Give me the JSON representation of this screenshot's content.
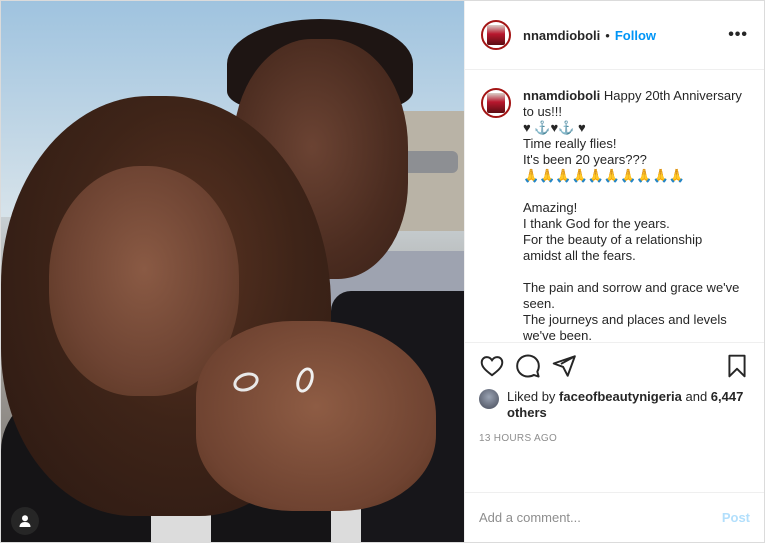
{
  "header": {
    "username": "nnamdioboli",
    "separator": "•",
    "follow_label": "Follow",
    "more_label": "•••"
  },
  "caption": {
    "username": "nnamdioboli",
    "text": "Happy 20th Anniversary to us!!!\n♥ ⚓♥⚓ ♥\nTime really flies!\nIt's been 20 years???\n🙏🙏🙏🙏🙏🙏🙏🙏🙏🙏\n\nAmazing!\nI thank God for the years.\nFor the beauty of a relationship amidst all the fears.\n\nThe pain and sorrow and grace we've seen.\nThe journeys and places and levels we've been.\n\nWe don't take it for granted that we got this far."
  },
  "actions": {
    "like_icon": "heart-icon",
    "comment_icon": "comment-icon",
    "share_icon": "send-icon",
    "save_icon": "bookmark-icon"
  },
  "likes": {
    "prefix": "Liked by ",
    "user": "faceofbeautynigeria",
    "middle": " and ",
    "others": "6,447 others"
  },
  "timestamp": "13 HOURS AGO",
  "comment": {
    "placeholder": "Add a comment...",
    "post_label": "Post"
  },
  "colors": {
    "accent": "#0095f6",
    "post_disabled": "#b2dffc",
    "avatar_ring": "#a31414"
  }
}
